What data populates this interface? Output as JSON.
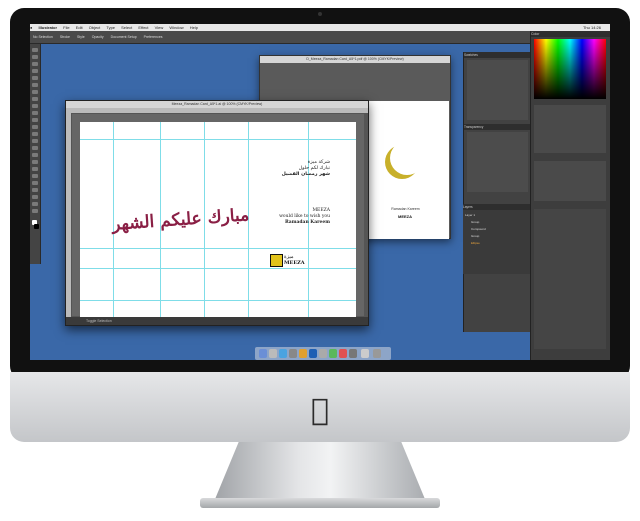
{
  "menubar": {
    "app_name": "Illustrator",
    "items": [
      "File",
      "Edit",
      "Object",
      "Type",
      "Select",
      "Effect",
      "View",
      "Window",
      "Help"
    ],
    "clock": "Thu 14:26"
  },
  "controlbar": {
    "selection": "No Selection",
    "stroke_label": "Stroke",
    "style_label": "Style",
    "opacity_label": "Opacity",
    "doc_setup": "Document Setup",
    "preferences": "Preferences"
  },
  "back_window": {
    "title": "D_Meeza_Ramadan Card_A5*1.pdf @ 100% (CMYK/Preview)",
    "caption": "Ramadan Kareem",
    "logo": "MEEZA"
  },
  "front_window": {
    "title": "Meeza_Ramadan Card_A5*1.ai @ 100% (CMYK/Preview)",
    "status": "Toggle Selection"
  },
  "card": {
    "calligraphy": "مبارك عليكم الشهر",
    "arabic_lines": [
      "شركة ميزة",
      "تبارك لكم حلول",
      "شهر رمضان الفضيل"
    ],
    "english_lines": [
      "MEEZA",
      "would like to wish you",
      "Ramadan Kareem"
    ],
    "logo_arabic": "ميزة",
    "logo_text": "MEEZA"
  },
  "panels": {
    "color": "Color",
    "swatches": "Swatches",
    "transparency": "Transparency",
    "layers": "Layers",
    "layer_rows": [
      "Layer 1",
      "Group",
      "Compound",
      "Group",
      "Ellipse"
    ]
  },
  "colors": {
    "accent_calligraphy": "#8a1f45",
    "moon": "#c8b02a",
    "logo_yellow": "#e2c31b",
    "desktop": "#3a68a8"
  },
  "brand": "apple-icon"
}
